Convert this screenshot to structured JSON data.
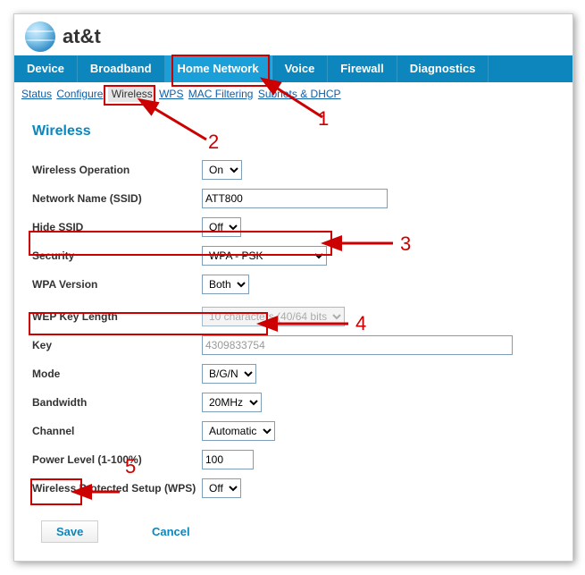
{
  "brand": "at&t",
  "topnav": [
    "Device",
    "Broadband",
    "Home Network",
    "Voice",
    "Firewall",
    "Diagnostics"
  ],
  "topnav_active_index": 2,
  "subnav": {
    "links_before": [
      "Status",
      "Configure"
    ],
    "current": "Wireless",
    "links_after": [
      "WPS",
      "MAC Filtering",
      "Subnets & DHCP"
    ]
  },
  "page_title": "Wireless",
  "fields": {
    "wireless_operation": {
      "label": "Wireless Operation",
      "value": "On"
    },
    "ssid": {
      "label": "Network Name (SSID)",
      "value": "ATT800"
    },
    "hide_ssid": {
      "label": "Hide SSID",
      "value": "Off"
    },
    "security": {
      "label": "Security",
      "value": "WPA - PSK"
    },
    "wpa_version": {
      "label": "WPA Version",
      "value": "Both"
    },
    "wep_key_length": {
      "label": "WEP Key Length",
      "value": "10 characters (40/64 bits)"
    },
    "key": {
      "label": "Key",
      "value": "4309833754"
    },
    "mode": {
      "label": "Mode",
      "value": "B/G/N"
    },
    "bandwidth": {
      "label": "Bandwidth",
      "value": "20MHz"
    },
    "channel": {
      "label": "Channel",
      "value": "Automatic"
    },
    "power_level": {
      "label": "Power Level (1-100%)",
      "value": "100"
    },
    "wps": {
      "label": "Wireless Protected Setup (WPS)",
      "value": "Off"
    }
  },
  "buttons": {
    "save": "Save",
    "cancel": "Cancel"
  },
  "annotations": [
    "1",
    "2",
    "3",
    "4",
    "5"
  ]
}
